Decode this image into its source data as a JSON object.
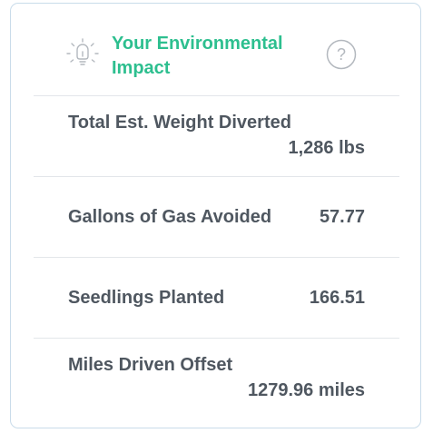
{
  "widget": {
    "title": "Your Environmental Impact",
    "icons": {
      "header": "lightbulb-icon",
      "help": "question-circle-icon"
    },
    "colors": {
      "title": "#2dbf8f",
      "text": "#4f5760",
      "border": "#c9dcea",
      "divider": "#e3e6ea"
    }
  },
  "metrics": [
    {
      "label": "Total Est. Weight Diverted",
      "value": "1,286 lbs"
    },
    {
      "label": "Gallons of Gas Avoided",
      "value": "57.77"
    },
    {
      "label": "Seedlings Planted",
      "value": "166.51"
    },
    {
      "label": "Miles Driven Offset",
      "value": "1279.96 miles"
    }
  ]
}
